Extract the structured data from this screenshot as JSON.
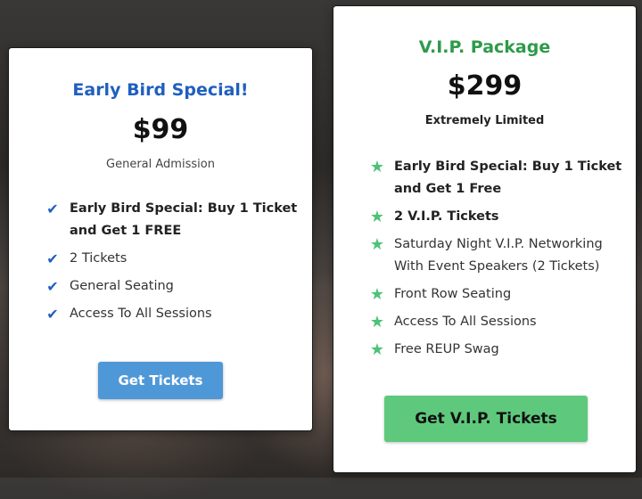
{
  "early_bird": {
    "title": "Early Bird Special!",
    "price": "$99",
    "subtitle": "General Admission",
    "features": [
      {
        "text": "Early Bird Special: Buy 1 Ticket and Get 1 FREE",
        "bold": true
      },
      {
        "text": "2 Tickets",
        "bold": false
      },
      {
        "text": "General Seating",
        "bold": false
      },
      {
        "text": "Access To All Sessions",
        "bold": false
      }
    ],
    "button_label": "Get Tickets",
    "accent_color": "#1f5fbf",
    "button_color": "#4f98d8"
  },
  "vip": {
    "title": "V.I.P. Package",
    "price": "$299",
    "subtitle": "Extremely Limited",
    "features": [
      {
        "text": "Early Bird Special:  Buy 1 Ticket and Get 1 Free",
        "bold": true
      },
      {
        "text": "2 V.I.P. Tickets",
        "bold": true
      },
      {
        "text": "Saturday Night V.I.P. Networking With Event Speakers (2 Tickets)",
        "bold": false
      },
      {
        "text": "Front Row Seating",
        "bold": false
      },
      {
        "text": "Access To All Sessions",
        "bold": false
      },
      {
        "text": "Free REUP Swag",
        "bold": false
      }
    ],
    "button_label": "Get V.I.P. Tickets",
    "accent_color": "#2e9a4a",
    "button_color": "#5ec97c"
  },
  "icons": {
    "early_bird_feature": "check-icon",
    "vip_feature": "star-icon"
  }
}
